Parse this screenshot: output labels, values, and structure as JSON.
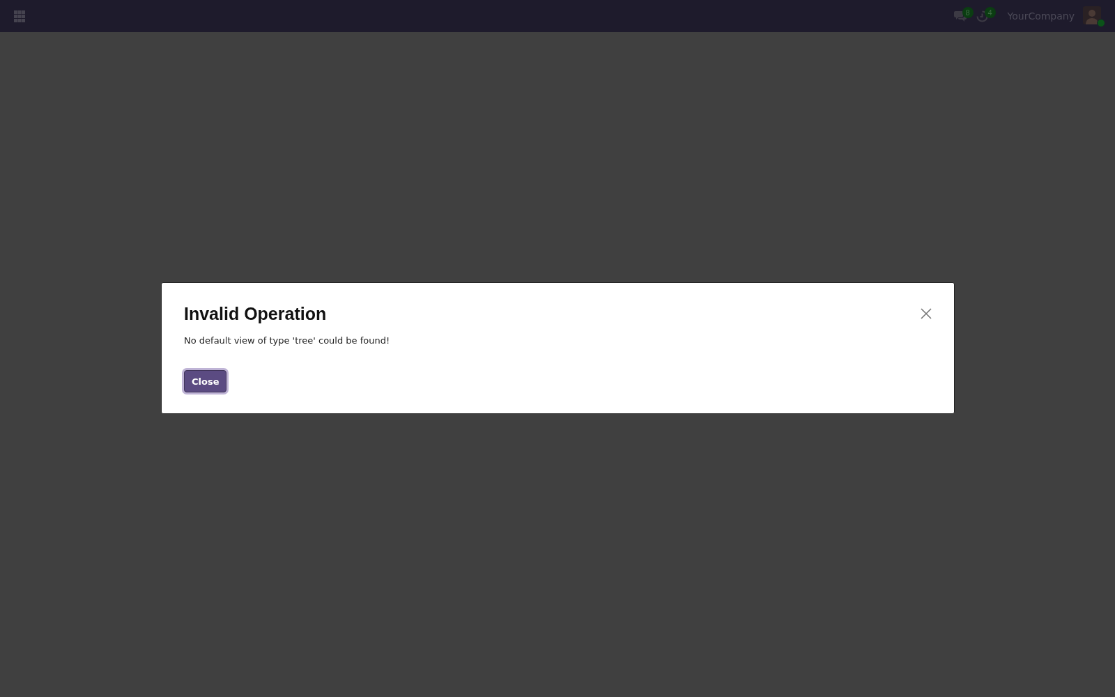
{
  "navbar": {
    "messages": {
      "count": "8"
    },
    "activities": {
      "count": "4"
    },
    "company": "YourCompany",
    "user": {
      "online": true
    }
  },
  "dialog": {
    "title": "Invalid Operation",
    "message": "No default view of type 'tree' could be found!",
    "buttons": [
      {
        "label": "Close",
        "focused": true
      }
    ]
  }
}
